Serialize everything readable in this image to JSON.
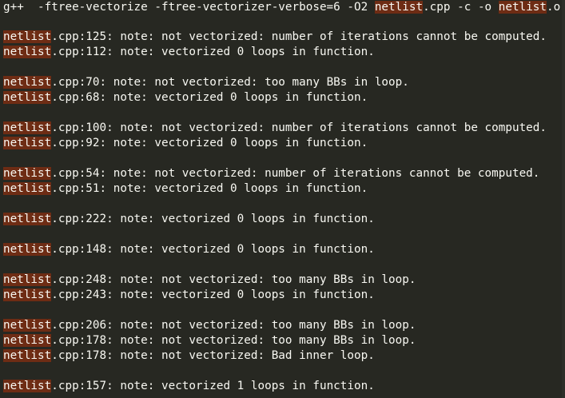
{
  "theme": {
    "background": "#272822",
    "foreground": "#f8f8f2",
    "match_highlight": "#6e2c14"
  },
  "command": {
    "prefix": "g++  -ftree-vectorize -ftree-vectorizer-verbose=6 -O2 ",
    "match1": "netlist",
    "middle": ".cpp -c -o ",
    "match2": "netlist",
    "suffix": ".o"
  },
  "output_lines": [
    {
      "match": "netlist",
      "rest": ".cpp:125: note: not vectorized: number of iterations cannot be computed."
    },
    {
      "match": "netlist",
      "rest": ".cpp:112: note: vectorized 0 loops in function."
    },
    {
      "match": "netlist",
      "rest": ".cpp:70: note: not vectorized: too many BBs in loop."
    },
    {
      "match": "netlist",
      "rest": ".cpp:68: note: vectorized 0 loops in function."
    },
    {
      "match": "netlist",
      "rest": ".cpp:100: note: not vectorized: number of iterations cannot be computed."
    },
    {
      "match": "netlist",
      "rest": ".cpp:92: note: vectorized 0 loops in function."
    },
    {
      "match": "netlist",
      "rest": ".cpp:54: note: not vectorized: number of iterations cannot be computed."
    },
    {
      "match": "netlist",
      "rest": ".cpp:51: note: vectorized 0 loops in function."
    },
    {
      "match": "netlist",
      "rest": ".cpp:222: note: vectorized 0 loops in function."
    },
    {
      "match": "netlist",
      "rest": ".cpp:148: note: vectorized 0 loops in function."
    },
    {
      "match": "netlist",
      "rest": ".cpp:248: note: not vectorized: too many BBs in loop."
    },
    {
      "match": "netlist",
      "rest": ".cpp:243: note: vectorized 0 loops in function."
    },
    {
      "match": "netlist",
      "rest": ".cpp:206: note: not vectorized: too many BBs in loop."
    },
    {
      "match": "netlist",
      "rest": ".cpp:178: note: not vectorized: too many BBs in loop."
    },
    {
      "match": "netlist",
      "rest": ".cpp:178: note: not vectorized: Bad inner loop."
    },
    {
      "match": "netlist",
      "rest": ".cpp:157: note: vectorized 1 loops in function."
    }
  ]
}
